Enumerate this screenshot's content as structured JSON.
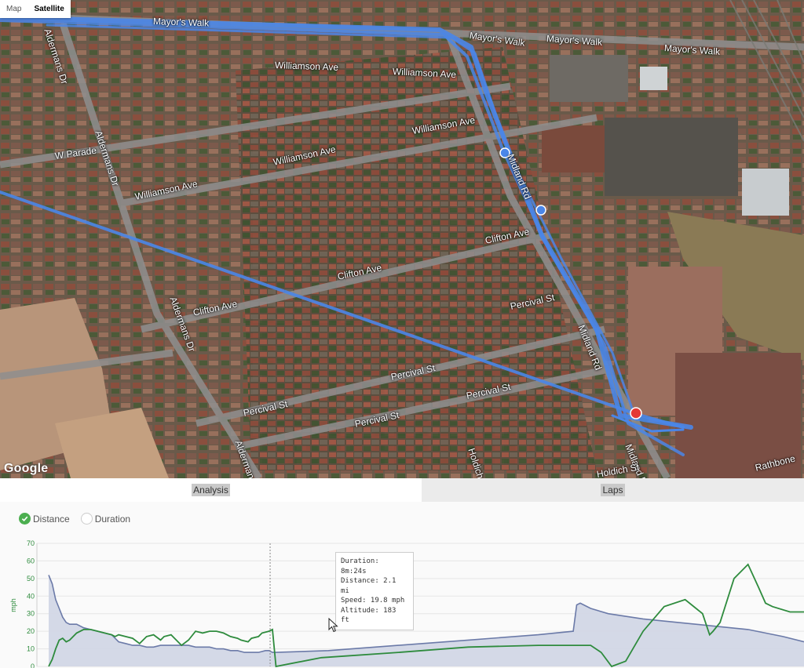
{
  "map": {
    "type_buttons": [
      "Map",
      "Satellite"
    ],
    "active_type": "Satellite",
    "attribution": "Google",
    "streets": [
      {
        "name": "Mayor's Walk"
      },
      {
        "name": "Mayor's Walk"
      },
      {
        "name": "Mayor's Walk"
      },
      {
        "name": "Mayor's Walk"
      },
      {
        "name": "Williamson Ave"
      },
      {
        "name": "Williamson Ave"
      },
      {
        "name": "Williamson Ave"
      },
      {
        "name": "Williamson Ave"
      },
      {
        "name": "Williamson Ave"
      },
      {
        "name": "W Parade"
      },
      {
        "name": "Aldermans Dr"
      },
      {
        "name": "Aldermans Dr"
      },
      {
        "name": "Aldermans Dr"
      },
      {
        "name": "Aldermans Dr"
      },
      {
        "name": "Clifton Ave"
      },
      {
        "name": "Clifton Ave"
      },
      {
        "name": "Clifton Ave"
      },
      {
        "name": "Percival St"
      },
      {
        "name": "Percival St"
      },
      {
        "name": "Percival St"
      },
      {
        "name": "Percival St"
      },
      {
        "name": "Percival St"
      },
      {
        "name": "Midland Rd"
      },
      {
        "name": "Midland Rd"
      },
      {
        "name": "Midland Rd"
      },
      {
        "name": "Holdich St"
      },
      {
        "name": "Holdich St"
      },
      {
        "name": "Rathbone"
      }
    ],
    "route_color": "#4a86e8",
    "marker_color": "#e53935"
  },
  "tabs": [
    "Analysis",
    "Laps"
  ],
  "legend": {
    "distance_label": "Distance",
    "duration_label": "Duration",
    "selected": "Distance"
  },
  "tooltip": {
    "duration": "Duration: 8m:24s",
    "distance": "Distance: 2.1 mi",
    "speed": "Speed: 19.8 mph",
    "altitude": "Altitude: 183 ft"
  },
  "chart_data": {
    "type": "area",
    "ylabel": "mph",
    "ylim": [
      0,
      70
    ],
    "y_ticks": [
      "0",
      "10",
      "20",
      "30",
      "40",
      "50",
      "60",
      "70"
    ],
    "grid": true,
    "colors": {
      "speed": "#2e8b3d",
      "altitude_line": "#6b7aa8",
      "altitude_fill": "#d2d7e6"
    },
    "series": [
      {
        "name": "Speed",
        "kind": "line",
        "points": [
          [
            0,
            0
          ],
          [
            1,
            4
          ],
          [
            2,
            10
          ],
          [
            3,
            15
          ],
          [
            4,
            16
          ],
          [
            5,
            14
          ],
          [
            6,
            15
          ],
          [
            8,
            19
          ],
          [
            10,
            21
          ],
          [
            12,
            21
          ],
          [
            14,
            20
          ],
          [
            16,
            19
          ],
          [
            18,
            18
          ],
          [
            19,
            17
          ],
          [
            20,
            18
          ],
          [
            22,
            17
          ],
          [
            24,
            16
          ],
          [
            26,
            13
          ],
          [
            28,
            17
          ],
          [
            30,
            18
          ],
          [
            32,
            15
          ],
          [
            33,
            17
          ],
          [
            35,
            18
          ],
          [
            36,
            16
          ],
          [
            38,
            12
          ],
          [
            40,
            15
          ],
          [
            42,
            20
          ],
          [
            44,
            19
          ],
          [
            46,
            20
          ],
          [
            48,
            20
          ],
          [
            50,
            19
          ],
          [
            52,
            17
          ],
          [
            54,
            16
          ],
          [
            55,
            15
          ],
          [
            57,
            14
          ],
          [
            58,
            16
          ],
          [
            60,
            17
          ],
          [
            61,
            19
          ],
          [
            63,
            20
          ],
          [
            64,
            21
          ],
          [
            65,
            0
          ],
          [
            78,
            5
          ],
          [
            100,
            8
          ],
          [
            120,
            11
          ],
          [
            140,
            12
          ],
          [
            155,
            12
          ],
          [
            158,
            8
          ],
          [
            161,
            0
          ],
          [
            165,
            3
          ],
          [
            170,
            20
          ],
          [
            176,
            34
          ],
          [
            182,
            38
          ],
          [
            187,
            30
          ],
          [
            189,
            18
          ],
          [
            190,
            20
          ],
          [
            192,
            25
          ],
          [
            196,
            50
          ],
          [
            200,
            58
          ],
          [
            203,
            45
          ],
          [
            205,
            36
          ],
          [
            207,
            34
          ],
          [
            212,
            31
          ],
          [
            216,
            31
          ]
        ]
      },
      {
        "name": "Altitude",
        "kind": "area",
        "points": [
          [
            0,
            52
          ],
          [
            1,
            47
          ],
          [
            2,
            38
          ],
          [
            3,
            33
          ],
          [
            4,
            28
          ],
          [
            5,
            25
          ],
          [
            6,
            24
          ],
          [
            8,
            24
          ],
          [
            10,
            22
          ],
          [
            12,
            21
          ],
          [
            14,
            20
          ],
          [
            16,
            19
          ],
          [
            18,
            18
          ],
          [
            19,
            16
          ],
          [
            20,
            14
          ],
          [
            22,
            13
          ],
          [
            24,
            12
          ],
          [
            26,
            12
          ],
          [
            28,
            11
          ],
          [
            30,
            11
          ],
          [
            32,
            12
          ],
          [
            34,
            12
          ],
          [
            36,
            12
          ],
          [
            38,
            12
          ],
          [
            40,
            12
          ],
          [
            42,
            11
          ],
          [
            44,
            11
          ],
          [
            46,
            11
          ],
          [
            48,
            10
          ],
          [
            50,
            10
          ],
          [
            52,
            9
          ],
          [
            54,
            9
          ],
          [
            56,
            8
          ],
          [
            58,
            8
          ],
          [
            60,
            8
          ],
          [
            62,
            9
          ],
          [
            63,
            9
          ],
          [
            64,
            8
          ],
          [
            65,
            8
          ],
          [
            80,
            9
          ],
          [
            100,
            12
          ],
          [
            120,
            15
          ],
          [
            140,
            18
          ],
          [
            150,
            20
          ],
          [
            151,
            35
          ],
          [
            152,
            36
          ],
          [
            153,
            35
          ],
          [
            155,
            33
          ],
          [
            160,
            30
          ],
          [
            170,
            27
          ],
          [
            180,
            25
          ],
          [
            190,
            23
          ],
          [
            200,
            21
          ],
          [
            210,
            17
          ],
          [
            216,
            14
          ]
        ]
      }
    ],
    "cursor_x": 64
  }
}
